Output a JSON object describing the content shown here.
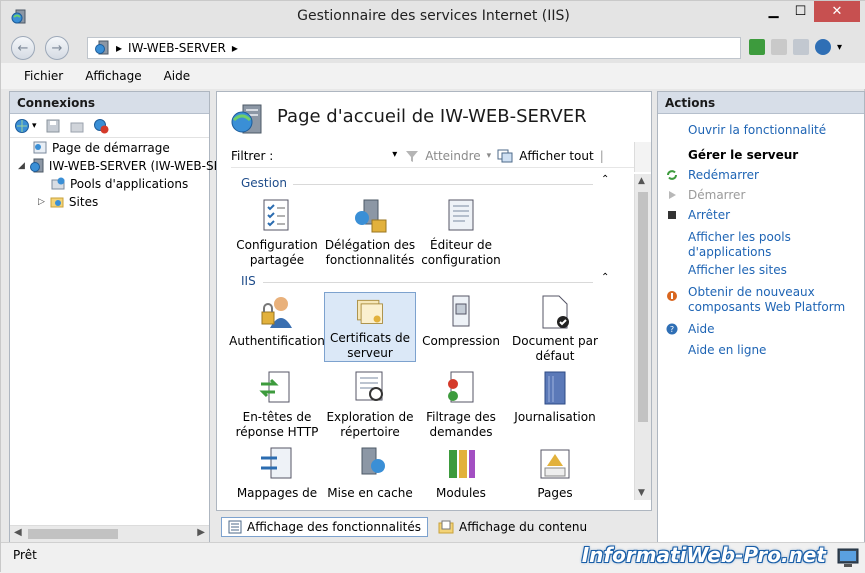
{
  "window": {
    "title": "Gestionnaire des services Internet (IIS)"
  },
  "address": {
    "segments": [
      "IW-WEB-SERVER"
    ]
  },
  "menu": [
    "Fichier",
    "Affichage",
    "Aide"
  ],
  "connections": {
    "header": "Connexions",
    "tree": [
      {
        "label": "Page de démarrage"
      },
      {
        "label": "IW-WEB-SERVER (IW-WEB-SE"
      },
      {
        "label": "Pools d'applications"
      },
      {
        "label": "Sites"
      }
    ]
  },
  "center": {
    "title": "Page d'accueil de IW-WEB-SERVER",
    "filter_label": "Filtrer :",
    "goto_label": "Atteindre",
    "show_all_label": "Afficher tout",
    "groups": [
      {
        "name": "Gestion"
      },
      {
        "name": "IIS"
      }
    ],
    "features": {
      "shared_config": [
        "Configuration",
        "partagée"
      ],
      "delegation": [
        "Délégation des",
        "fonctionnalités"
      ],
      "config_editor": [
        "Éditeur de",
        "configuration"
      ],
      "auth": [
        "Authentification"
      ],
      "certs": [
        "Certificats de",
        "serveur"
      ],
      "compression": [
        "Compression"
      ],
      "default_doc": [
        "Document par",
        "défaut"
      ],
      "http_headers": [
        "En-têtes de",
        "réponse HTTP"
      ],
      "dir_browse": [
        "Exploration de",
        "répertoire"
      ],
      "request_filter": [
        "Filtrage des",
        "demandes"
      ],
      "logging": [
        "Journalisation"
      ],
      "handler_mappings": [
        "Mappages de"
      ],
      "output_cache": [
        "Mise en cache"
      ],
      "modules": [
        "Modules"
      ],
      "error_pages": [
        "Pages d'erreurs"
      ]
    },
    "view_tabs": [
      "Affichage des fonctionnalités",
      "Affichage du contenu"
    ]
  },
  "actions": {
    "header": "Actions",
    "open_feature": "Ouvrir la fonctionnalité",
    "manage_server": "Gérer le serveur",
    "restart": "Redémarrer",
    "start": "Démarrer",
    "stop": "Arrêter",
    "view_pools": [
      "Afficher les pools",
      "d'applications"
    ],
    "view_sites": "Afficher les sites",
    "new_components": [
      "Obtenir de nouveaux",
      "composants Web Platform"
    ],
    "help": "Aide",
    "online_help": "Aide en ligne"
  },
  "status": {
    "text": "Prêt"
  },
  "watermark": "InformatiWeb-Pro.net"
}
